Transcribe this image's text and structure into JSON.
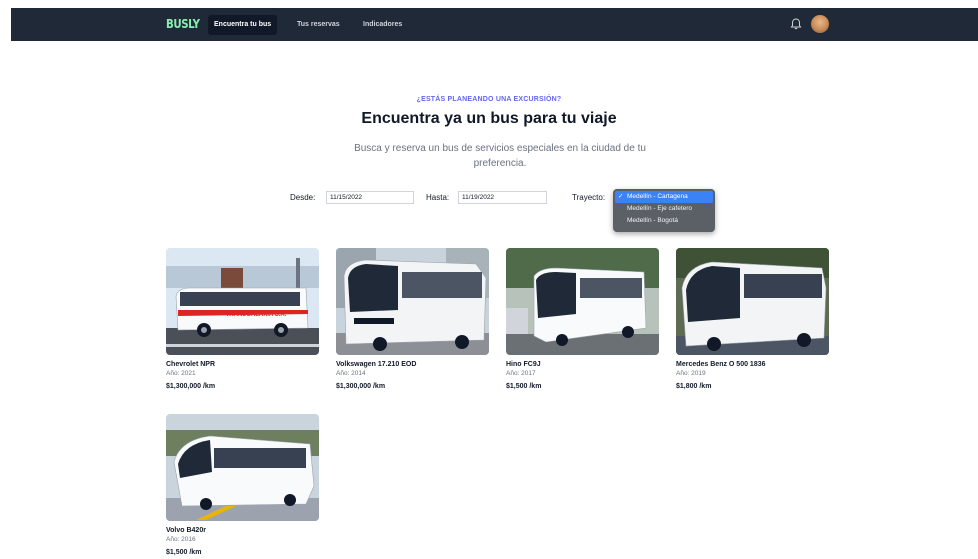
{
  "nav": {
    "logo": "BUSLY",
    "links": [
      {
        "label": "Encuentra tu bus",
        "active": true
      },
      {
        "label": "Tus reservas",
        "active": false
      },
      {
        "label": "Indicadores",
        "active": false
      }
    ],
    "icons": [
      "bell-icon",
      "avatar"
    ]
  },
  "hero": {
    "kicker": "¿ESTÁS PLANEANDO UNA EXCURSIÓN?",
    "title": "Encuentra ya un bus para tu viaje",
    "subtitle": "Busca y reserva un bus de servicios especiales en la ciudad de tu preferencia."
  },
  "filters": {
    "desde_label": "Desde:",
    "desde_value": "11/15/2022",
    "hasta_label": "Hasta:",
    "hasta_value": "11/19/2022",
    "trayecto_label": "Trayecto:",
    "trayecto_options": [
      {
        "label": "Medellín - Cartagena",
        "selected": true
      },
      {
        "label": "Medellín - Eje cafetero",
        "selected": false
      },
      {
        "label": "Medellín - Bogotá",
        "selected": false
      }
    ],
    "check": "✓"
  },
  "buses": [
    {
      "name": "Chevrolet NPR",
      "year": "Año: 2021",
      "price": "$1,300,000 /km",
      "livery": "TRANSGALAXIA S.A."
    },
    {
      "name": "Volkswagen 17.210 EOD",
      "year": "Año: 2014",
      "price": "$1,300,000 /km"
    },
    {
      "name": "Hino FC9J",
      "year": "Año: 2017",
      "price": "$1,500 /km"
    },
    {
      "name": "Mercedes Benz O 500 1836",
      "year": "Año: 2019",
      "price": "$1,800 /km"
    },
    {
      "name": "Volvo B420r",
      "year": "Año: 2016",
      "price": "$1,500 /km"
    }
  ],
  "colors": {
    "nav_bg": "#1f2937",
    "logo": "#86efac",
    "accent": "#6366f1",
    "dropdown_selected": "#3b82f6"
  }
}
